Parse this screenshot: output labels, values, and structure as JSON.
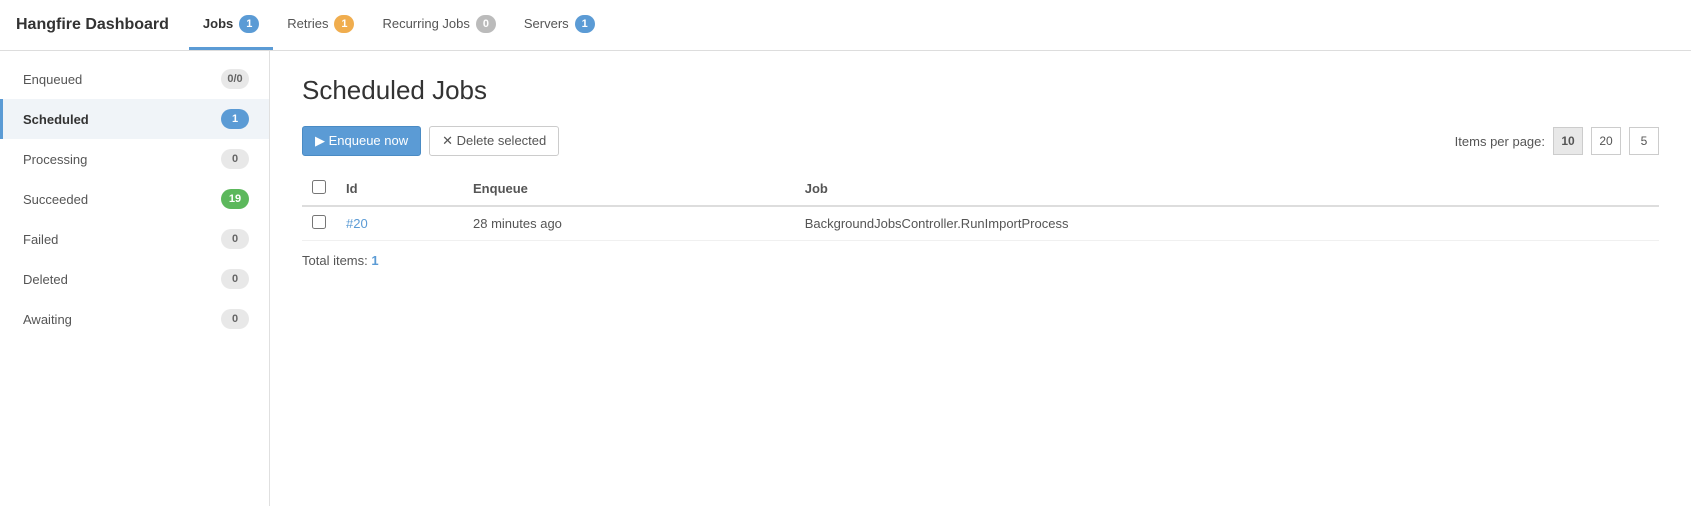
{
  "brand": "Hangfire Dashboard",
  "nav": {
    "tabs": [
      {
        "id": "jobs",
        "label": "Jobs",
        "badge": "1",
        "badgeType": "blue",
        "active": true
      },
      {
        "id": "retries",
        "label": "Retries",
        "badge": "1",
        "badgeType": "orange",
        "active": false
      },
      {
        "id": "recurring-jobs",
        "label": "Recurring Jobs",
        "badge": "0",
        "badgeType": "gray",
        "active": false
      },
      {
        "id": "servers",
        "label": "Servers",
        "badge": "1",
        "badgeType": "blue",
        "active": false
      }
    ]
  },
  "sidebar": {
    "items": [
      {
        "id": "enqueued",
        "label": "Enqueued",
        "badge": "0/0",
        "badgeType": "gray",
        "active": false
      },
      {
        "id": "scheduled",
        "label": "Scheduled",
        "badge": "1",
        "badgeType": "blue",
        "active": true
      },
      {
        "id": "processing",
        "label": "Processing",
        "badge": "0",
        "badgeType": "gray",
        "active": false
      },
      {
        "id": "succeeded",
        "label": "Succeeded",
        "badge": "19",
        "badgeType": "green",
        "active": false
      },
      {
        "id": "failed",
        "label": "Failed",
        "badge": "0",
        "badgeType": "gray",
        "active": false
      },
      {
        "id": "deleted",
        "label": "Deleted",
        "badge": "0",
        "badgeType": "gray",
        "active": false
      },
      {
        "id": "awaiting",
        "label": "Awaiting",
        "badge": "0",
        "badgeType": "gray",
        "active": false
      }
    ]
  },
  "main": {
    "title": "Scheduled Jobs",
    "toolbar": {
      "enqueue_now": "▶ Enqueue now",
      "delete_selected": "✕ Delete selected"
    },
    "items_per_page_label": "Items per page:",
    "pager": [
      "10",
      "20",
      "5"
    ],
    "table": {
      "columns": [
        "",
        "Id",
        "Enqueue",
        "Job"
      ],
      "rows": [
        {
          "id": "#20",
          "enqueue": "28 minutes ago",
          "job": "BackgroundJobsController.RunImportProcess"
        }
      ]
    },
    "total_items_label": "Total items:",
    "total_count": "1"
  }
}
